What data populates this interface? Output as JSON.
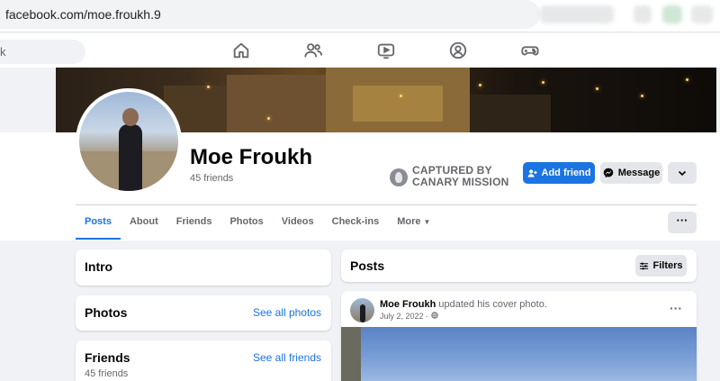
{
  "browser": {
    "url": "facebook.com/moe.froukh.9"
  },
  "topnav": {
    "search_placeholder_fragment": "k",
    "icons": [
      "home-icon",
      "friends-icon",
      "watch-icon",
      "groups-icon",
      "gaming-icon"
    ]
  },
  "profile": {
    "name": "Moe Froukh",
    "friends_count": "45 friends",
    "overlay_line1": "CAPTURED BY",
    "overlay_line2": "CANARY MISSION"
  },
  "actions": {
    "add_friend": "Add friend",
    "message": "Message"
  },
  "tabs": [
    "Posts",
    "About",
    "Friends",
    "Photos",
    "Videos",
    "Check-ins",
    "More"
  ],
  "more_glyph": "···",
  "intro": {
    "title": "Intro"
  },
  "photos": {
    "title": "Photos",
    "link": "See all photos"
  },
  "friends": {
    "title": "Friends",
    "link": "See all friends",
    "count": "45 friends"
  },
  "posts": {
    "title": "Posts",
    "filters": "Filters",
    "item": {
      "author": "Moe Froukh",
      "action": "updated his cover photo.",
      "date": "July 2, 2022 ·"
    }
  },
  "colors": {
    "brand_blue": "#1b74e4",
    "page_bg": "#f0f2f5",
    "secondary_button": "#e4e6eb"
  }
}
